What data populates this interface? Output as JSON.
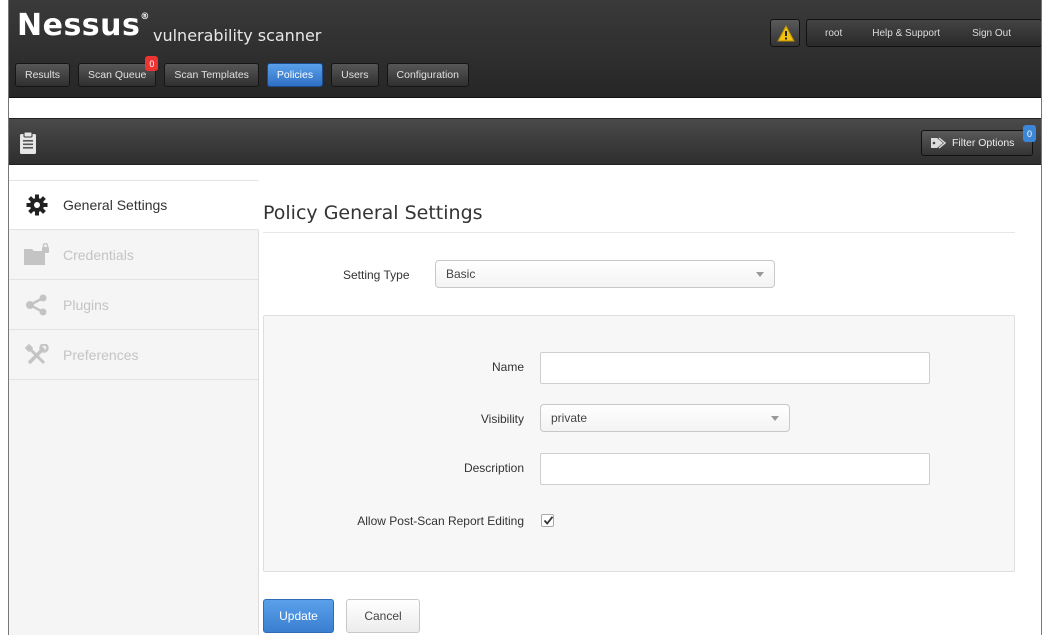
{
  "header": {
    "logo": "Nessus",
    "logo_mark": "®",
    "subtitle": "vulnerability scanner",
    "user": "root",
    "help": "Help & Support",
    "signout": "Sign Out"
  },
  "nav": {
    "results": "Results",
    "scan_queue": "Scan Queue",
    "scan_queue_badge": "0",
    "scan_templates": "Scan Templates",
    "policies": "Policies",
    "users": "Users",
    "configuration": "Configuration"
  },
  "toolbar": {
    "filter_label": "Filter Options",
    "filter_badge": "0"
  },
  "sidebar": {
    "items": [
      {
        "label": "General Settings",
        "icon": "gear-icon"
      },
      {
        "label": "Credentials",
        "icon": "folder-lock-icon"
      },
      {
        "label": "Plugins",
        "icon": "share-nodes-icon"
      },
      {
        "label": "Preferences",
        "icon": "tools-icon"
      }
    ]
  },
  "main": {
    "title": "Policy General Settings",
    "setting_type_label": "Setting Type",
    "setting_type_value": "Basic",
    "name_label": "Name",
    "name_value": "",
    "visibility_label": "Visibility",
    "visibility_value": "private",
    "description_label": "Description",
    "description_value": "",
    "allow_edit_label": "Allow Post-Scan Report Editing",
    "allow_edit_checked": true,
    "update_label": "Update",
    "cancel_label": "Cancel"
  },
  "colors": {
    "accent_blue": "#3a7fd0",
    "badge_red": "#e33333",
    "warning_yellow": "#f4c20d"
  }
}
